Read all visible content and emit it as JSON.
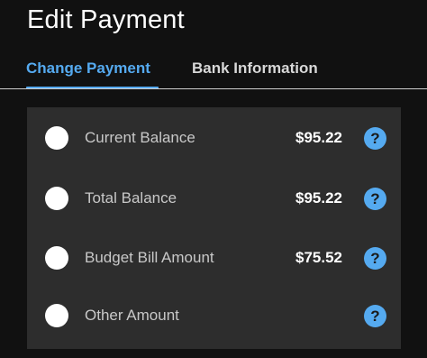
{
  "header": {
    "title": "Edit Payment"
  },
  "tabs": [
    {
      "label": "Change Payment",
      "active": true
    },
    {
      "label": "Bank Information",
      "active": false
    }
  ],
  "payment_options": [
    {
      "label": "Current Balance",
      "amount": "$95.22",
      "selected": false
    },
    {
      "label": "Total Balance",
      "amount": "$95.22",
      "selected": false
    },
    {
      "label": "Budget Bill Amount",
      "amount": "$75.52",
      "selected": false
    },
    {
      "label": "Other Amount",
      "amount": "",
      "selected": false
    }
  ],
  "help_glyph": "?",
  "colors": {
    "accent": "#55aaf0",
    "background": "#111111",
    "panel": "#2d2d2d"
  },
  "icons": [
    "radio-button",
    "help-icon"
  ]
}
